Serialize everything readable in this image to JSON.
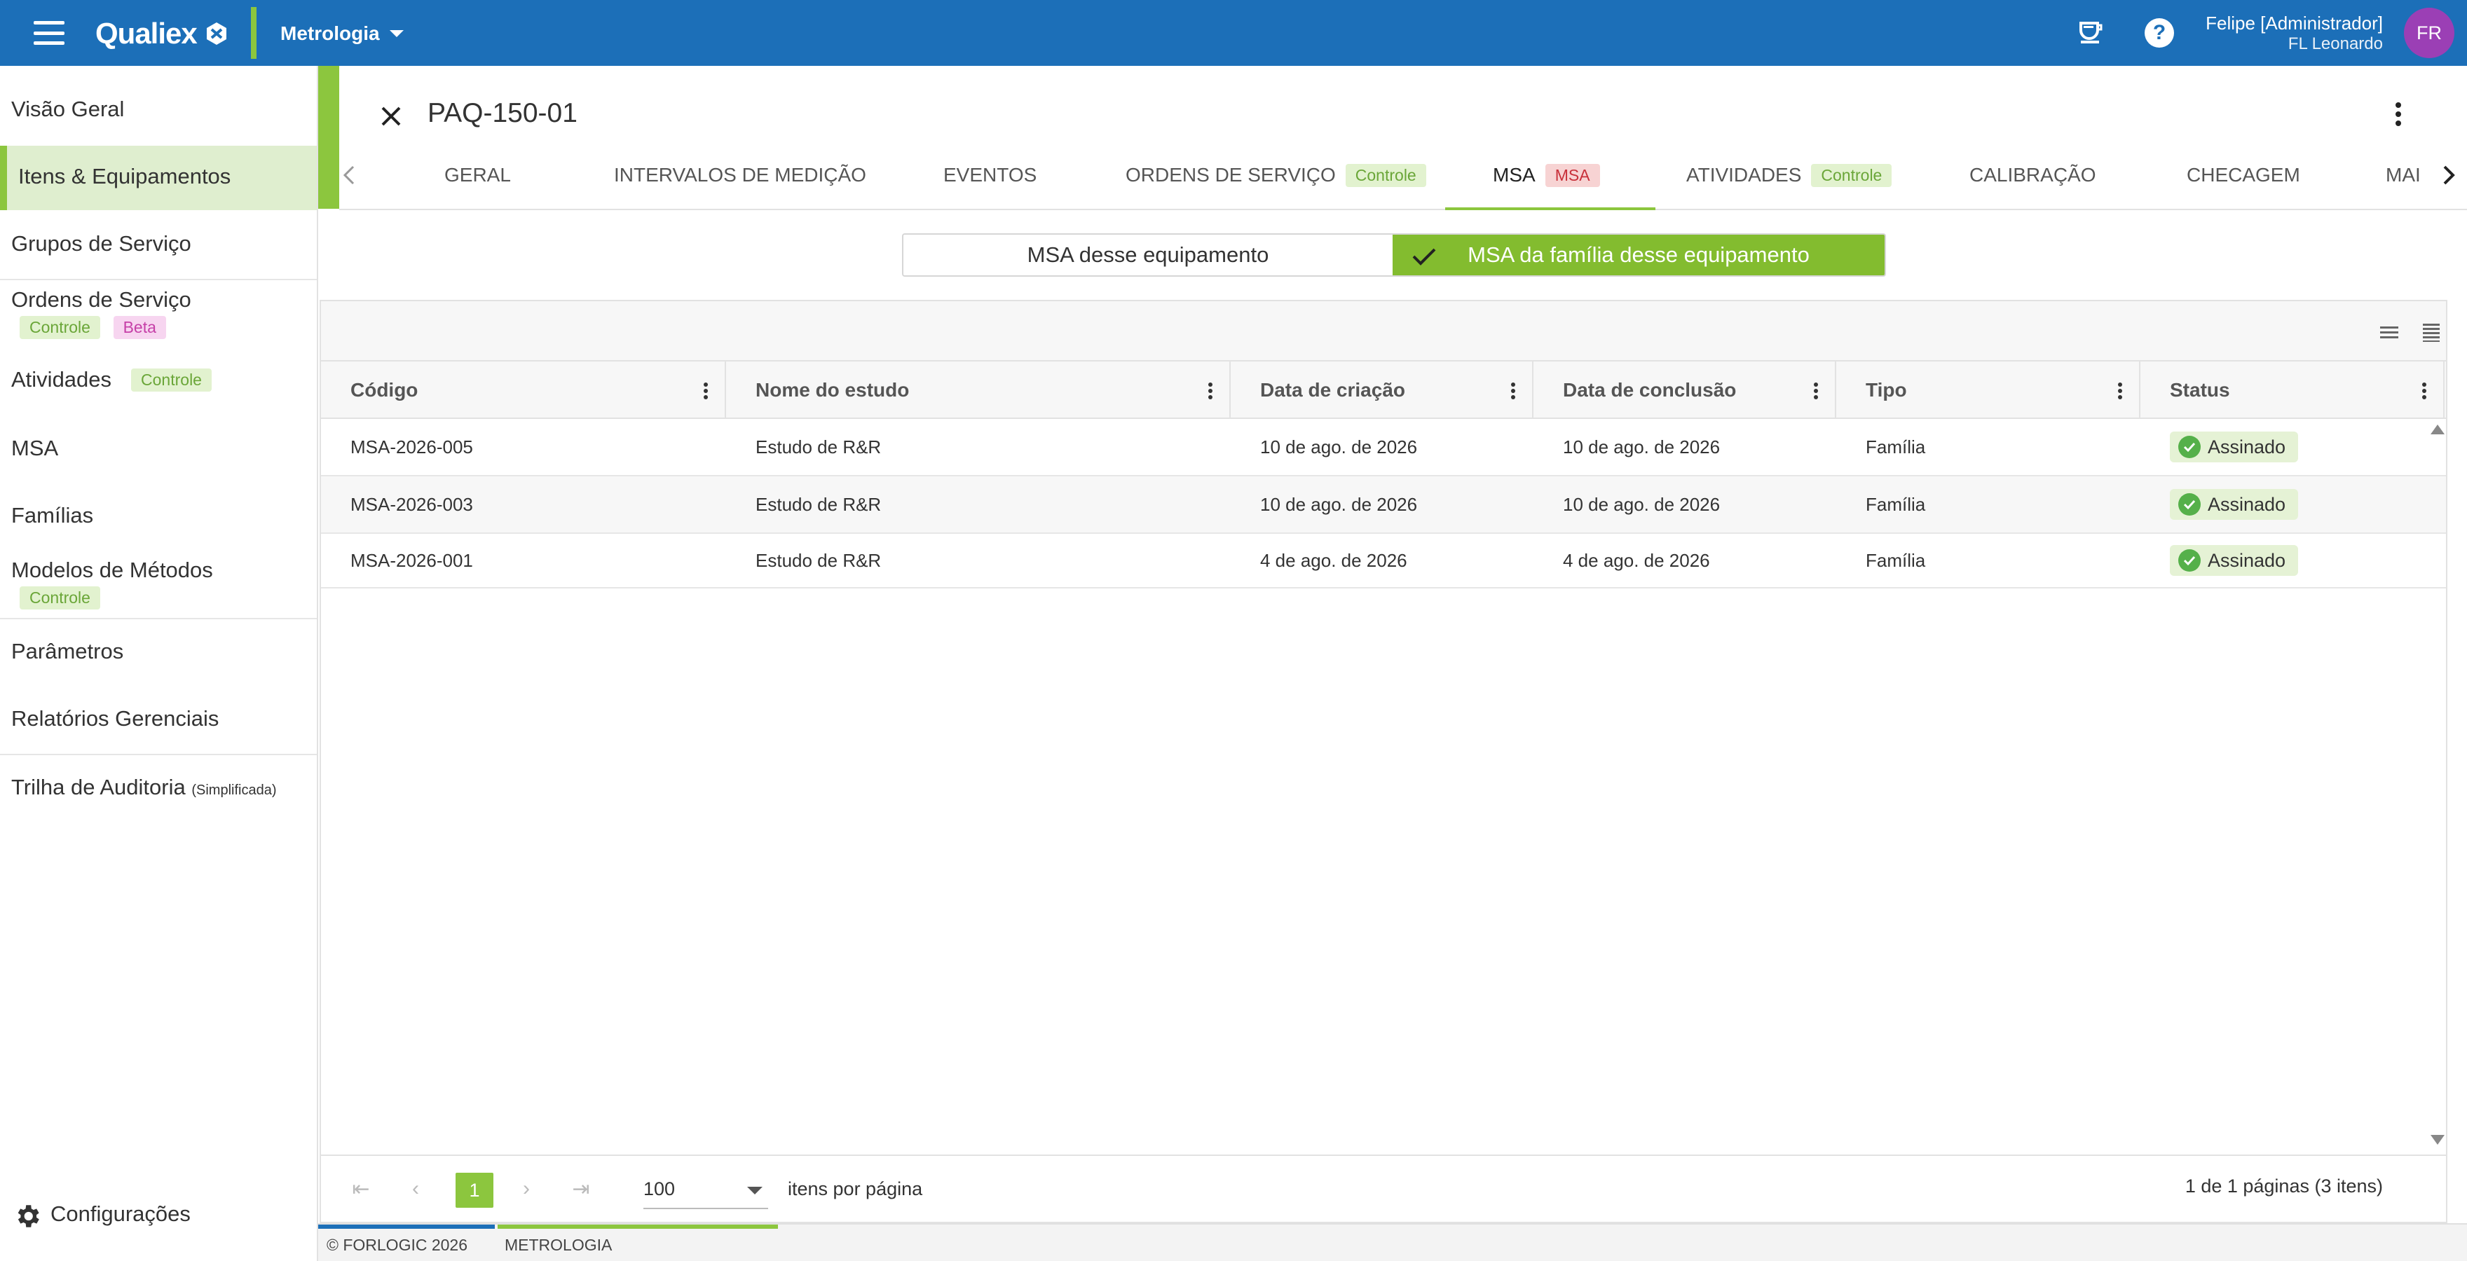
{
  "app": {
    "brand": "Qualiex",
    "module": "Metrologia",
    "user_name": "Felipe [Administrador]",
    "user_org": "FL Leonardo",
    "avatar_initials": "FR",
    "colors": {
      "topbar": "#1c6fb8",
      "accent_green": "#8cc63e",
      "avatar": "#9b3fb5"
    }
  },
  "sidebar": {
    "items": [
      {
        "label": "Visão Geral"
      },
      {
        "label": "Itens & Equipamentos",
        "active": true
      },
      {
        "label": "Grupos de Serviço"
      },
      {
        "label": "Ordens de Serviço",
        "badges": [
          "Controle",
          "Beta"
        ]
      },
      {
        "label": "Atividades",
        "badges": [
          "Controle"
        ]
      },
      {
        "label": "MSA"
      },
      {
        "label": "Famílias"
      },
      {
        "label": "Modelos de Métodos",
        "badges": [
          "Controle"
        ]
      },
      {
        "label": "Parâmetros"
      },
      {
        "label": "Relatórios Gerenciais"
      },
      {
        "label": "Trilha de Auditoria",
        "suffix": "(Simplificada)"
      }
    ],
    "settings_label": "Configurações"
  },
  "page": {
    "title": "PAQ-150-01"
  },
  "tabs": [
    {
      "label": "GERAL"
    },
    {
      "label": "INTERVALOS DE MEDIÇÃO"
    },
    {
      "label": "EVENTOS"
    },
    {
      "label": "ORDENS DE SERVIÇO",
      "badge": "Controle"
    },
    {
      "label": "MSA",
      "badge": "MSA",
      "active": true
    },
    {
      "label": "ATIVIDADES",
      "badge": "Controle"
    },
    {
      "label": "CALIBRAÇÃO"
    },
    {
      "label": "CHECAGEM"
    },
    {
      "label": "MAI"
    }
  ],
  "toggle": {
    "left_label": "MSA desse equipamento",
    "right_label": "MSA da família desse equipamento",
    "selected": "right"
  },
  "grid": {
    "columns": [
      "Código",
      "Nome do estudo",
      "Data de criação",
      "Data de conclusão",
      "Tipo",
      "Status"
    ],
    "rows": [
      [
        "MSA-2026-005",
        "Estudo de R&R",
        "10 de ago. de 2026",
        "10 de ago. de 2026",
        "Família",
        "Assinado"
      ],
      [
        "MSA-2026-003",
        "Estudo de R&R",
        "10 de ago. de 2026",
        "10 de ago. de 2026",
        "Família",
        "Assinado"
      ],
      [
        "MSA-2026-001",
        "Estudo de R&R",
        "4 de ago. de 2026",
        "4 de ago. de 2026",
        "Família",
        "Assinado"
      ]
    ]
  },
  "pager": {
    "current_page": "1",
    "page_size": "100",
    "per_page_label": "itens por página",
    "info": "1 de 1 páginas (3 itens)"
  },
  "footer": {
    "copyright": "© FORLOGIC 2026",
    "module": "METROLOGIA"
  }
}
